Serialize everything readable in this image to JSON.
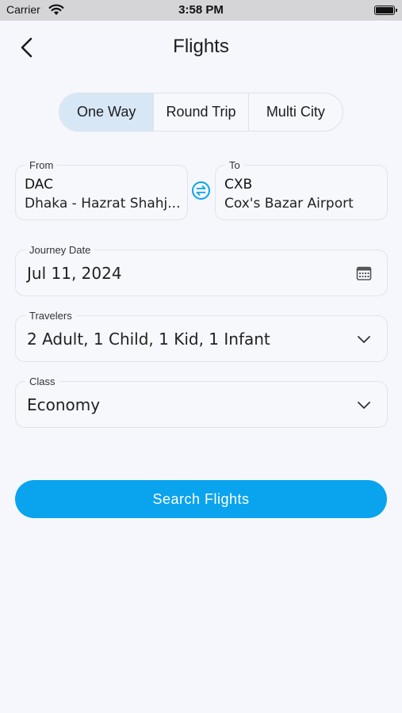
{
  "status_bar": {
    "carrier": "Carrier",
    "time": "3:58 PM"
  },
  "header": {
    "title": "Flights"
  },
  "trip_types": [
    "One Way",
    "Round Trip",
    "Multi City"
  ],
  "active_trip_type": "One Way",
  "from": {
    "label": "From",
    "code": "DAC",
    "airport": "Dhaka - Hazrat Shahj..."
  },
  "to": {
    "label": "To",
    "code": "CXB",
    "airport": "Cox's Bazar Airport"
  },
  "journey_date": {
    "label": "Journey Date",
    "value": "Jul 11, 2024"
  },
  "travelers": {
    "label": "Travelers",
    "value": "2 Adult, 1 Child, 1 Kid, 1 Infant"
  },
  "travel_class": {
    "label": "Class",
    "value": "Economy"
  },
  "search_button": {
    "label": "Search Flights"
  },
  "colors": {
    "accent": "#0aa3ee",
    "active_tab": "#d8e7f6",
    "background": "#f5f7fc"
  }
}
